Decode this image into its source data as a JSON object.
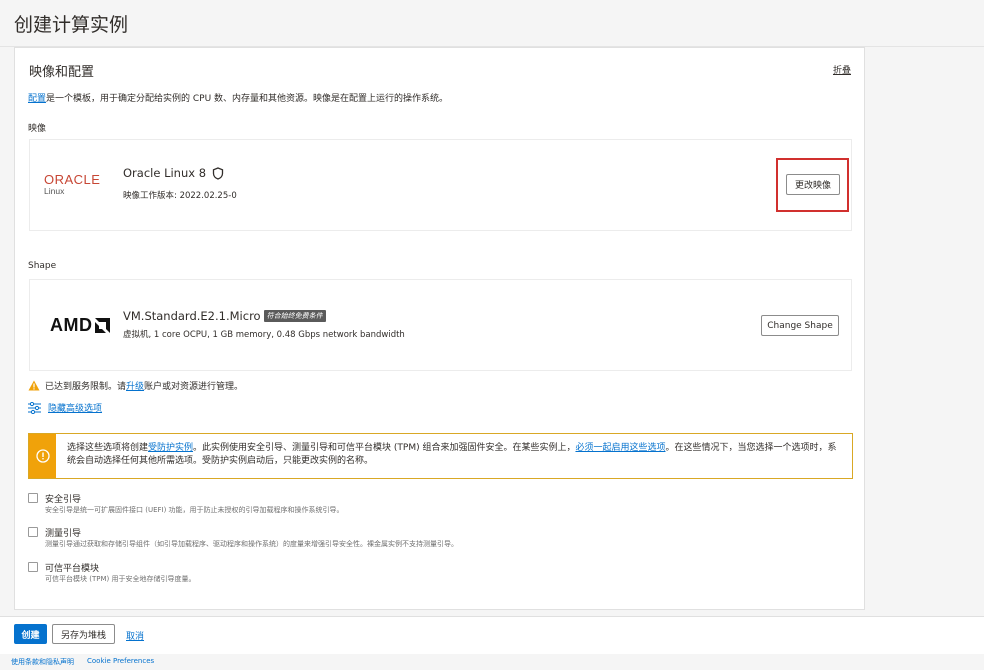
{
  "page": {
    "title": "创建计算实例"
  },
  "image_section": {
    "title": "映像和配置",
    "collapse_label": "折叠",
    "desc_link": "配置",
    "desc_rest": "是一个模板，用于确定分配给实例的 CPU 数、内存量和其他资源。映像是在配置上运行的操作系统。",
    "image_label": "映像",
    "image": {
      "logo_word": "ORACLE",
      "logo_sub": "Linux",
      "name": "Oracle Linux 8",
      "build_prefix": "映像工作版本: ",
      "build": "2022.02.25-0",
      "change_button": "更改映像"
    },
    "shape_label": "Shape",
    "shape": {
      "logo_word": "AMD",
      "name": "VM.Standard.E2.1.Micro",
      "badge": "符合始终免费条件",
      "details": "虚拟机, 1 core OCPU, 1 GB memory, 0.48 Gbps network bandwidth",
      "change_button": "Change Shape"
    },
    "limit_warning": {
      "prefix": "已达到服务限制。请",
      "link": "升级",
      "suffix": "账户或对资源进行管理。"
    },
    "advanced_link": "隐藏高级选项"
  },
  "notice": {
    "part1": "选择这些选项将创建",
    "link1": "受防护实例",
    "part2": "。此实例使用安全引导、测量引导和可信平台模块 (TPM) 组合来加强固件安全。在某些实例上，",
    "link2": "必须一起启用这些选项",
    "part3": "。在这些情况下，当您选择一个选项时，系统会自动选择任何其他所需选项。受防护实例启动后，只能更改实例的名称。"
  },
  "options": [
    {
      "label": "安全引导",
      "help": "安全引导是统一可扩展固件接口 (UEFI) 功能，用于防止未授权的引导加载程序和操作系统引导。"
    },
    {
      "label": "测量引导",
      "help": "测量引导通过获取和存储引导组件（如引导加载程序、驱动程序和操作系统）的度量来增强引导安全性。裸金属实例不支持测量引导。"
    },
    {
      "label": "可信平台模块",
      "help": "可信平台模块 (TPM) 用于安全地存储引导度量。"
    }
  ],
  "footer": {
    "create": "创建",
    "save_stack": "另存为堆栈",
    "cancel": "取消"
  },
  "bottom_links": [
    "使用条款和隐私声明",
    "Cookie Preferences"
  ],
  "colors": {
    "accent": "#0572ce",
    "highlight": "#d1302e",
    "warning": "#f0a20a",
    "oracle_red": "#c74634"
  }
}
